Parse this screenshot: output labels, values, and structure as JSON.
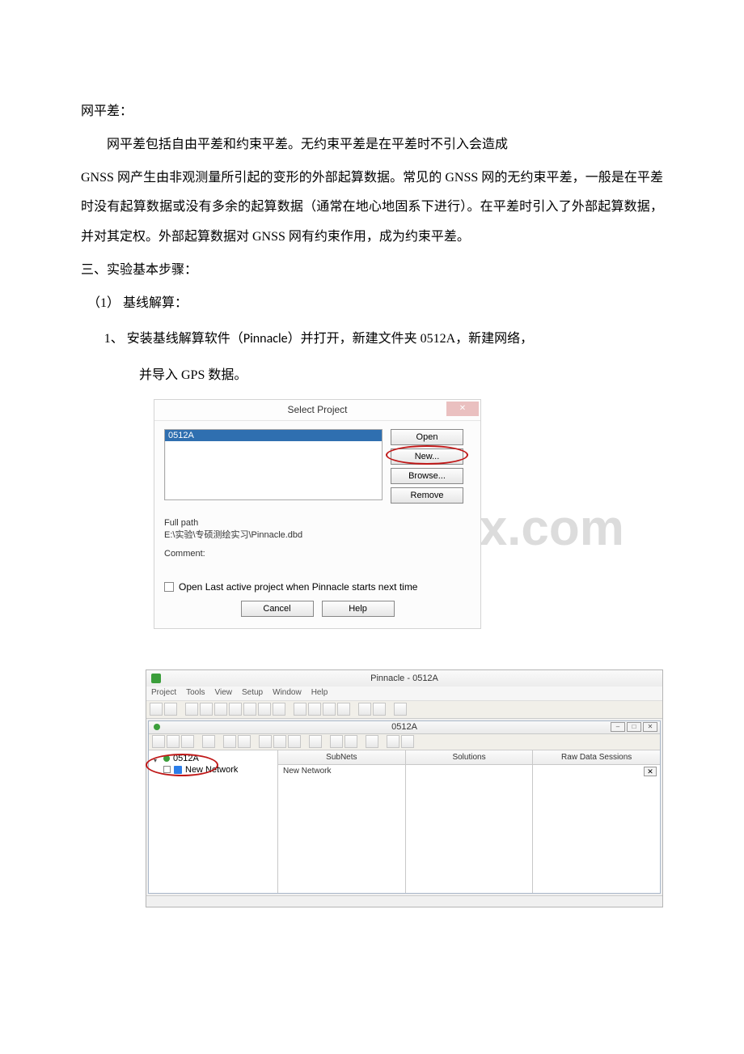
{
  "para": {
    "h1": "网平差：",
    "p1": "网平差包括自由平差和约束平差。无约束平差是在平差时不引入会造成",
    "p2": "GNSS 网产生由非观测量所引起的变形的外部起算数据。常见的 GNSS 网的无约束平差，一般是在平差时没有起算数据或没有多余的起算数据（通常在地心地固系下进行）。在平差时引入了外部起算数据，并对其定权。外部起算数据对 GNSS 网有约束作用，成为约束平差。",
    "h2": "三、实验基本步骤：",
    "l1": "（1）  基线解算：",
    "l2a": "1、  安装基线解算软件（",
    "l2b": "Pinnacle",
    "l2c": "）并打开，新建文件夹 0512A，新建网络，",
    "l2d": "并导入 GPS 数据。"
  },
  "watermark": "www.bdocx.com",
  "dialog": {
    "title": "Select Project",
    "item": "0512A",
    "btn_open": "Open",
    "btn_new": "New...",
    "btn_browse": "Browse...",
    "btn_remove": "Remove",
    "fullpath_label": "Full path",
    "fullpath_value": "E:\\实验\\专硕测绘实习\\Pinnacle.dbd",
    "comment_label": "Comment:",
    "cb_label": "Open Last active project when Pinnacle starts next time",
    "cancel": "Cancel",
    "help": "Help"
  },
  "app": {
    "title": "Pinnacle - 0512A",
    "menu": {
      "m1": "Project",
      "m2": "Tools",
      "m3": "View",
      "m4": "Setup",
      "m5": "Window",
      "m6": "Help"
    },
    "subtitle": "0512A",
    "tree_root": "0512A",
    "tree_child": "New Network",
    "hdr1": "SubNets",
    "hdr2": "Solutions",
    "hdr3": "Raw Data Sessions",
    "subnet_label": "New Network"
  }
}
